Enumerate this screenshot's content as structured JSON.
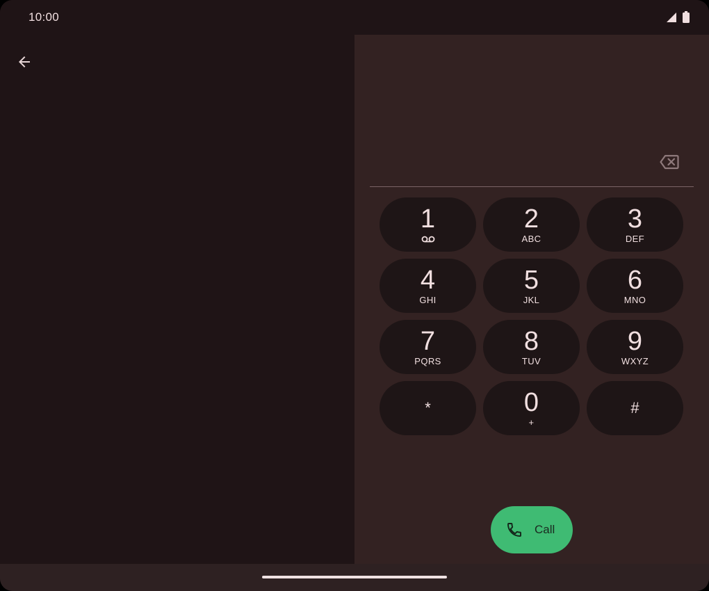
{
  "status_bar": {
    "time": "10:00",
    "icons": [
      "signal-icon",
      "battery-icon"
    ]
  },
  "header": {
    "back_icon": "arrow-back-icon"
  },
  "dialer": {
    "number_value": "",
    "backspace_icon": "backspace-icon",
    "keys": [
      {
        "digit": "1",
        "letters": "",
        "icon": "voicemail-icon"
      },
      {
        "digit": "2",
        "letters": "ABC"
      },
      {
        "digit": "3",
        "letters": "DEF"
      },
      {
        "digit": "4",
        "letters": "GHI"
      },
      {
        "digit": "5",
        "letters": "JKL"
      },
      {
        "digit": "6",
        "letters": "MNO"
      },
      {
        "digit": "7",
        "letters": "PQRS"
      },
      {
        "digit": "8",
        "letters": "TUV"
      },
      {
        "digit": "9",
        "letters": "WXYZ"
      },
      {
        "digit": "*",
        "letters": ""
      },
      {
        "digit": "0",
        "letters": "+"
      },
      {
        "digit": "#",
        "letters": ""
      }
    ],
    "call_label": "Call",
    "call_icon": "phone-icon"
  },
  "colors": {
    "background": "#1f1416",
    "dialpad_panel": "#332222",
    "key_background": "#1e1516",
    "text": "#f1dfe0",
    "call_button": "#3fbb73"
  }
}
